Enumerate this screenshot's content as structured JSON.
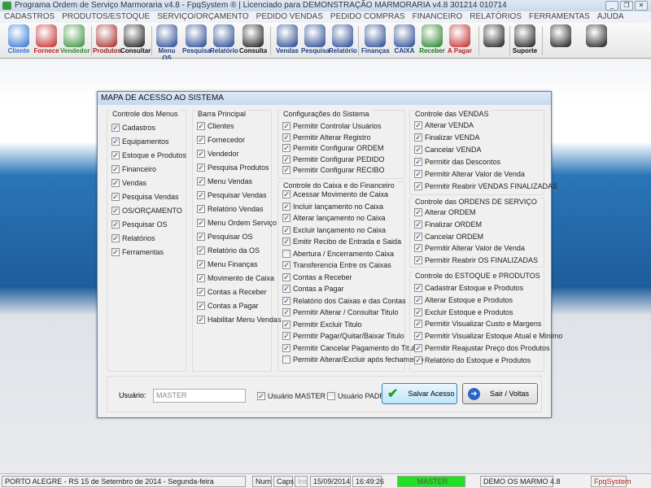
{
  "window": {
    "title": "Programa Ordem de Serviço Marmoraria v4.8 - FpqSystem ® | Licenciado para  DEMONSTRAÇÃO MARMORARIA v4.8 301214 010714"
  },
  "menu": [
    "CADASTROS",
    "PRODUTOS/ESTOQUE",
    "SERVIÇO/ORÇAMENTO",
    "PEDIDO VENDAS",
    "PEDIDO COMPRAS",
    "FINANCEIRO",
    "RELATÓRIOS",
    "FERRAMENTAS",
    "AJUDA"
  ],
  "toolbar": [
    {
      "label": "Cliente",
      "icon": "client-icon",
      "color": "#2a6fd0"
    },
    {
      "label": "Fornece",
      "icon": "supplier-icon",
      "color": "#c02020"
    },
    {
      "label": "Vendedor",
      "icon": "seller-icon",
      "color": "#2f8a2f"
    },
    {
      "label": "Produtos",
      "icon": "products-icon",
      "color": "#a02020"
    },
    {
      "label": "Consultar",
      "icon": "barcode-icon",
      "color": "#111"
    },
    {
      "label": "Menu OS",
      "icon": "clipboard-icon",
      "color": "#1b3f8a"
    },
    {
      "label": "Pesquisa",
      "icon": "search-doc-icon",
      "color": "#1b3f8a"
    },
    {
      "label": "Relatório",
      "icon": "report-icon",
      "color": "#1b3f8a"
    },
    {
      "label": "Consulta",
      "icon": "folder-icon",
      "color": "#111"
    },
    {
      "label": "Vendas",
      "icon": "monitor-icon",
      "color": "#1b3f8a"
    },
    {
      "label": "Pesquisa",
      "icon": "search-doc-icon",
      "color": "#1b3f8a"
    },
    {
      "label": "Relatório",
      "icon": "report-icon",
      "color": "#1b3f8a"
    },
    {
      "label": "Finanças",
      "icon": "finance-icon",
      "color": "#1b3f8a"
    },
    {
      "label": "CAIXA",
      "icon": "cashbook-icon",
      "color": "#1b3f8a"
    },
    {
      "label": "Receber",
      "icon": "receive-dollar-icon",
      "color": "#1b7a1b"
    },
    {
      "label": "A Pagar",
      "icon": "pay-dollar-icon",
      "color": "#c02020"
    },
    {
      "label": "",
      "icon": "calculator-icon",
      "color": "#111"
    },
    {
      "label": "Suporte",
      "icon": "support-icon",
      "color": "#111"
    },
    {
      "label": "",
      "icon": "coins-icon",
      "color": "#111"
    },
    {
      "label": "",
      "icon": "exit-door-icon",
      "color": "#111"
    }
  ],
  "dialog": {
    "title": "MAPA DE ACESSO AO SISTEMA",
    "groups": [
      {
        "title": "Controle dos Menus",
        "items": [
          [
            "Cadastros",
            1
          ],
          [
            "Equipamentos",
            1
          ],
          [
            "Estoque e Produtos",
            1
          ],
          [
            "Financeiro",
            1
          ],
          [
            "Vendas",
            1
          ],
          [
            "Pesquisa Vendas",
            1
          ],
          [
            "OS/ORÇAMENTO",
            1
          ],
          [
            "Pesquisar OS",
            1
          ],
          [
            "Relatórios",
            1
          ],
          [
            "Ferramentas",
            1
          ]
        ]
      },
      {
        "title": "Barra Principal",
        "items": [
          [
            "Clientes",
            1
          ],
          [
            "Fornecedor",
            1
          ],
          [
            "Vendedor",
            1
          ],
          [
            "Pesquisa Produtos",
            1
          ],
          [
            "Menu Vendas",
            1
          ],
          [
            "Pesquisar Vendas",
            1
          ],
          [
            "Relatório Vendas",
            1
          ],
          [
            "Menu Ordem Serviço",
            1
          ],
          [
            "Pesquisar OS",
            1
          ],
          [
            "Relatório da OS",
            1
          ],
          [
            "Menu Finanças",
            1
          ],
          [
            "Movimento de Caixa",
            1
          ],
          [
            "Contas a Receber",
            1
          ],
          [
            "Contas a Pagar",
            1
          ],
          [
            "Habilitar Menu Vendas",
            1
          ]
        ]
      },
      {
        "title": "Configurações do Sistema",
        "items": [
          [
            "Permitir Controlar Usuários",
            1
          ],
          [
            "Permitir Alterar Registro",
            1
          ],
          [
            "Permitir Configurar ORDEM",
            1
          ],
          [
            "Permitir Configurar PEDIDO",
            1
          ],
          [
            "Permitir Configurar RECIBO",
            1
          ]
        ]
      },
      {
        "title": "Controle do Caixa e do Financeiro",
        "items": [
          [
            "Acessar Movimento de Caixa",
            1
          ],
          [
            "Incluir lançamento no Caixa",
            1
          ],
          [
            "Alterar lançamento no Caixa",
            1
          ],
          [
            "Excluir lançamento no Caixa",
            1
          ],
          [
            "Emitir Recibo de Entrada e Saida",
            1
          ],
          [
            "Abertura / Encerramento Caixa",
            0
          ],
          [
            "Transferencia Entre os Caixas",
            1
          ],
          [
            "Contas a Receber",
            1
          ],
          [
            "Contas a Pagar",
            1
          ],
          [
            "Relatório dos Caixas e das Contas",
            1
          ],
          [
            "Permitir Alterar / Consultar Titulo",
            1
          ],
          [
            "Permitir Excluir Titulo",
            1
          ],
          [
            "Permitir Pagar/Quitar/Baixar Titulo",
            1
          ],
          [
            "Permitir Cancelar Pagamento do Titulo",
            1
          ],
          [
            "Permitir Alterar/Excluir após fechamento",
            0
          ]
        ]
      },
      {
        "title": "Controle das VENDAS",
        "items": [
          [
            "Alterar VENDA",
            1
          ],
          [
            "Finalizar VENDA",
            1
          ],
          [
            "Cancelar VENDA",
            1
          ],
          [
            "Permitir das Descontos",
            1
          ],
          [
            "Permitir Alterar Valor de Venda",
            1
          ],
          [
            "Permitir Reabrir VENDAS FINALIZADAS",
            1
          ]
        ]
      },
      {
        "title": "Controle das ORDENS DE SERVIÇO",
        "items": [
          [
            "Alterar ORDEM",
            1
          ],
          [
            "Finalizar ORDEM",
            1
          ],
          [
            "Cancelar ORDEM",
            1
          ],
          [
            "Permitir Alterar Valor de Venda",
            1
          ],
          [
            "Permitir Reabrir OS FINALIZADAS",
            1
          ]
        ]
      },
      {
        "title": "Controle do ESTOQUE e PRODUTOS",
        "items": [
          [
            "Cadastrar Estoque e Produtos",
            1
          ],
          [
            "Alterar Estoque e Produtos",
            1
          ],
          [
            "Excluir Estoque e Produtos",
            1
          ],
          [
            "Permitir Visualizar Custo e Margens",
            1
          ],
          [
            "Permitir Visualizar Estoque Atual e Minimo",
            1
          ],
          [
            "Permitir Reajustar Preço dos Produtos",
            1
          ],
          [
            "Relatório do Estoque e Produtos",
            1
          ]
        ]
      }
    ],
    "user_label": "Usuário:",
    "user_value": "MASTER",
    "master_label": "Usuário MASTER",
    "master_checked": true,
    "padrao_label": "Usuário PADRÃO",
    "padrao_checked": false,
    "save_label": "Salvar Acesso",
    "exit_label": "Sair / Voltas"
  },
  "status": {
    "location": "PORTO ALEGRE - RS 15 de Setembro de 2014 - Segunda-feira",
    "num": "Num",
    "caps": "Caps",
    "ins": "Ins",
    "date": "15/09/2014",
    "time": "16:49:26",
    "user": "MASTER",
    "user_color": "#22e022",
    "db": "DEMO OS MARMO 4.8",
    "brand": "FpqSystem"
  }
}
